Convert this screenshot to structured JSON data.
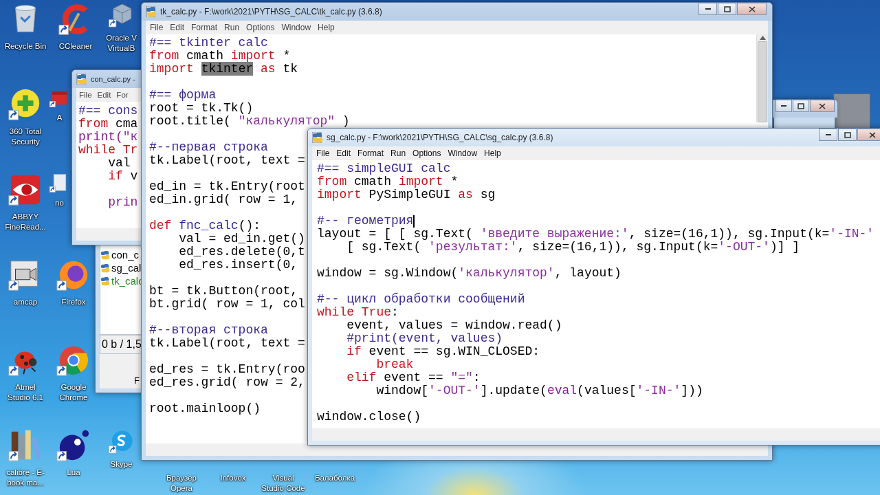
{
  "desktop_icons": [
    {
      "label": "Recycle Bin",
      "kind": "recycle",
      "shortcut": false
    },
    {
      "label": "CCleaner",
      "kind": "ccleaner",
      "shortcut": true
    },
    {
      "label": "Oracle V\nVirtualB",
      "kind": "cube",
      "shortcut": true
    },
    {
      "label": "360 Total Security",
      "kind": "plus",
      "shortcut": true
    },
    {
      "label": "A",
      "kind": "redapp",
      "shortcut": true
    },
    {
      "label": "ABBYY FineRead...",
      "kind": "eye",
      "shortcut": true
    },
    {
      "label": "no",
      "kind": "doc",
      "shortcut": true
    },
    {
      "label": "amcap",
      "kind": "camera",
      "shortcut": true
    },
    {
      "label": "Firefox",
      "kind": "firefox",
      "shortcut": true
    },
    {
      "label": "Atmel Studio 6.1",
      "kind": "ladybug",
      "shortcut": true
    },
    {
      "label": "Google Chrome",
      "kind": "chrome",
      "shortcut": true
    },
    {
      "label": "calibre - E-book ma...",
      "kind": "books",
      "shortcut": true
    },
    {
      "label": "Lua",
      "kind": "lua",
      "shortcut": true
    },
    {
      "label": "Skype",
      "kind": "skype",
      "shortcut": true
    },
    {
      "label": "Браузер Opera",
      "kind": "hidden"
    },
    {
      "label": "Infovox",
      "kind": "hidden"
    },
    {
      "label": "Visual Studio Code",
      "kind": "hidden"
    },
    {
      "label": "Балаболка",
      "kind": "hidden"
    }
  ],
  "windows": [
    {
      "kind": "editor",
      "title": "tk_calc.py - F:\\work\\2021\\PYTH\\SG_CALC\\tk_calc.py (3.6.8)",
      "active": false,
      "scrollbar": true,
      "menu": [
        "File",
        "Edit",
        "Format",
        "Run",
        "Options",
        "Window",
        "Help"
      ],
      "lines": [
        {
          "kind": "code",
          "tokens": [
            {
              "kind": "c",
              "text": "#== tkinter calc"
            }
          ]
        },
        {
          "kind": "code",
          "tokens": [
            {
              "kind": "k",
              "text": "from"
            },
            {
              "kind": "p",
              "text": " cmath "
            },
            {
              "kind": "k",
              "text": "import"
            },
            {
              "kind": "p",
              "text": " *"
            }
          ]
        },
        {
          "kind": "code",
          "tokens": [
            {
              "kind": "k",
              "text": "import "
            },
            {
              "kind": "sel",
              "text": "tkinter"
            },
            {
              "kind": "k",
              "text": " as"
            },
            {
              "kind": "p",
              "text": " tk"
            }
          ]
        },
        {
          "kind": "blank"
        },
        {
          "kind": "code",
          "tokens": [
            {
              "kind": "c",
              "text": "#== форма"
            }
          ]
        },
        {
          "kind": "code",
          "tokens": [
            {
              "kind": "p",
              "text": "root = tk.Tk()"
            }
          ]
        },
        {
          "kind": "code",
          "tokens": [
            {
              "kind": "p",
              "text": "root.title( "
            },
            {
              "kind": "s",
              "text": "\"калькулятор\""
            },
            {
              "kind": "p",
              "text": " )"
            }
          ]
        },
        {
          "kind": "blank"
        },
        {
          "kind": "code",
          "tokens": [
            {
              "kind": "c",
              "text": "#--первая строка"
            }
          ]
        },
        {
          "kind": "code",
          "tokens": [
            {
              "kind": "p",
              "text": "tk.Label(root, text ="
            }
          ]
        },
        {
          "kind": "blank"
        },
        {
          "kind": "code",
          "tokens": [
            {
              "kind": "p",
              "text": "ed_in = tk.Entry(root"
            }
          ]
        },
        {
          "kind": "code",
          "tokens": [
            {
              "kind": "p",
              "text": "ed_in.grid( row = 1,"
            }
          ]
        },
        {
          "kind": "blank"
        },
        {
          "kind": "code",
          "tokens": [
            {
              "kind": "k",
              "text": "def"
            },
            {
              "kind": "d",
              "text": " fnc_calc"
            },
            {
              "kind": "p",
              "text": "():"
            }
          ]
        },
        {
          "kind": "code",
          "tokens": [
            {
              "kind": "p",
              "text": "    val = ed_in.get()"
            }
          ]
        },
        {
          "kind": "code",
          "tokens": [
            {
              "kind": "p",
              "text": "    ed_res.delete(0,t"
            }
          ]
        },
        {
          "kind": "code",
          "tokens": [
            {
              "kind": "p",
              "text": "    ed_res.insert(0,"
            }
          ]
        },
        {
          "kind": "blank"
        },
        {
          "kind": "code",
          "tokens": [
            {
              "kind": "p",
              "text": "bt = tk.Button(root,"
            }
          ]
        },
        {
          "kind": "code",
          "tokens": [
            {
              "kind": "p",
              "text": "bt.grid( row = 1, col"
            }
          ]
        },
        {
          "kind": "blank"
        },
        {
          "kind": "code",
          "tokens": [
            {
              "kind": "c",
              "text": "#--вторая строка"
            }
          ]
        },
        {
          "kind": "code",
          "tokens": [
            {
              "kind": "p",
              "text": "tk.Label(root, text ="
            }
          ]
        },
        {
          "kind": "blank"
        },
        {
          "kind": "code",
          "tokens": [
            {
              "kind": "p",
              "text": "ed_res = tk.Entry(roo"
            }
          ]
        },
        {
          "kind": "code",
          "tokens": [
            {
              "kind": "p",
              "text": "ed_res.grid( row = 2,"
            }
          ]
        },
        {
          "kind": "blank"
        },
        {
          "kind": "code",
          "tokens": [
            {
              "kind": "p",
              "text": "root.mainloop()"
            }
          ]
        }
      ]
    },
    {
      "kind": "editor",
      "title": "con_calc.py -",
      "active": false,
      "scrollbar": false,
      "menu": [
        "File",
        "Edit",
        "For"
      ],
      "lines": [
        {
          "kind": "code",
          "tokens": [
            {
              "kind": "c",
              "text": "#== cons"
            }
          ]
        },
        {
          "kind": "code",
          "tokens": [
            {
              "kind": "k",
              "text": "from"
            },
            {
              "kind": "p",
              "text": " cma"
            }
          ]
        },
        {
          "kind": "code",
          "tokens": [
            {
              "kind": "b",
              "text": "print("
            },
            {
              "kind": "s",
              "text": "\"к"
            }
          ]
        },
        {
          "kind": "code",
          "tokens": [
            {
              "kind": "k",
              "text": "while"
            },
            {
              "kind": "k",
              "text": " Tr"
            }
          ]
        },
        {
          "kind": "code",
          "tokens": [
            {
              "kind": "p",
              "text": "    val"
            }
          ]
        },
        {
          "kind": "code",
          "tokens": [
            {
              "kind": "k",
              "text": "    if"
            },
            {
              "kind": "p",
              "text": " v"
            }
          ]
        },
        {
          "kind": "blank"
        },
        {
          "kind": "code",
          "tokens": [
            {
              "kind": "b",
              "text": "    prin"
            }
          ]
        }
      ]
    },
    {
      "kind": "frame",
      "active": false
    },
    {
      "kind": "editor",
      "title": "sg_calc.py - F:\\work\\2021\\PYTH\\SG_CALC\\sg_calc.py (3.6.8)",
      "active": true,
      "scrollbar": false,
      "menu": [
        "File",
        "Edit",
        "Format",
        "Run",
        "Options",
        "Window",
        "Help"
      ],
      "lines": [
        {
          "kind": "code",
          "tokens": [
            {
              "kind": "c",
              "text": "#== simpleGUI calc"
            }
          ]
        },
        {
          "kind": "code",
          "tokens": [
            {
              "kind": "k",
              "text": "from"
            },
            {
              "kind": "p",
              "text": " cmath "
            },
            {
              "kind": "k",
              "text": "import"
            },
            {
              "kind": "p",
              "text": " *"
            }
          ]
        },
        {
          "kind": "code",
          "tokens": [
            {
              "kind": "k",
              "text": "import"
            },
            {
              "kind": "p",
              "text": " PySimpleGUI "
            },
            {
              "kind": "k",
              "text": "as"
            },
            {
              "kind": "p",
              "text": " sg"
            }
          ]
        },
        {
          "kind": "blank"
        },
        {
          "kind": "code",
          "tokens": [
            {
              "kind": "c",
              "text": "#-- геометрия"
            },
            {
              "kind": "caret"
            }
          ]
        },
        {
          "kind": "code",
          "tokens": [
            {
              "kind": "p",
              "text": "layout = [ [ sg.Text( "
            },
            {
              "kind": "s",
              "text": "'введите выражение:'"
            },
            {
              "kind": "p",
              "text": ", size=(16,1)), sg.Input(k="
            },
            {
              "kind": "s",
              "text": "'-IN-'"
            }
          ]
        },
        {
          "kind": "code",
          "tokens": [
            {
              "kind": "p",
              "text": "    [ sg.Text( "
            },
            {
              "kind": "s",
              "text": "'результат:'"
            },
            {
              "kind": "p",
              "text": ", size=(16,1)), sg.Input(k="
            },
            {
              "kind": "s",
              "text": "'-OUT-'"
            },
            {
              "kind": "p",
              "text": ")] ]"
            }
          ]
        },
        {
          "kind": "blank"
        },
        {
          "kind": "code",
          "tokens": [
            {
              "kind": "p",
              "text": "window = sg.Window("
            },
            {
              "kind": "s",
              "text": "'калькулятор'"
            },
            {
              "kind": "p",
              "text": ", layout)"
            }
          ]
        },
        {
          "kind": "blank"
        },
        {
          "kind": "code",
          "tokens": [
            {
              "kind": "c",
              "text": "#-- цикл обработки сообщений"
            }
          ]
        },
        {
          "kind": "code",
          "tokens": [
            {
              "kind": "k",
              "text": "while"
            },
            {
              "kind": "k",
              "text": " True"
            },
            {
              "kind": "p",
              "text": ":"
            }
          ]
        },
        {
          "kind": "code",
          "tokens": [
            {
              "kind": "p",
              "text": "    event, values = window.read()"
            }
          ]
        },
        {
          "kind": "code",
          "tokens": [
            {
              "kind": "c",
              "text": "    #print(event, values)"
            }
          ]
        },
        {
          "kind": "code",
          "tokens": [
            {
              "kind": "k",
              "text": "    if"
            },
            {
              "kind": "p",
              "text": " event == sg.WIN_CLOSED:"
            }
          ]
        },
        {
          "kind": "code",
          "tokens": [
            {
              "kind": "k",
              "text": "        break"
            }
          ]
        },
        {
          "kind": "code",
          "tokens": [
            {
              "kind": "k",
              "text": "    elif"
            },
            {
              "kind": "p",
              "text": " event == "
            },
            {
              "kind": "s",
              "text": "\"=\""
            },
            {
              "kind": "p",
              "text": ":"
            }
          ]
        },
        {
          "kind": "code",
          "tokens": [
            {
              "kind": "p",
              "text": "        window["
            },
            {
              "kind": "s",
              "text": "'-OUT-'"
            },
            {
              "kind": "p",
              "text": "].update("
            },
            {
              "kind": "b",
              "text": "eval"
            },
            {
              "kind": "p",
              "text": "(values["
            },
            {
              "kind": "s",
              "text": "'-IN-'"
            },
            {
              "kind": "p",
              "text": "]))"
            }
          ]
        },
        {
          "kind": "blank"
        },
        {
          "kind": "code",
          "tokens": [
            {
              "kind": "p",
              "text": "window.close()"
            }
          ]
        }
      ]
    },
    {
      "kind": "filelist",
      "files": [
        {
          "name": "con_c",
          "color": "#000000"
        },
        {
          "name": "sg_cal",
          "color": "#000000"
        },
        {
          "name": "tk_calc",
          "color": "#1f8a1f"
        }
      ],
      "status": "0 b / 1,5",
      "footer": "F"
    }
  ]
}
